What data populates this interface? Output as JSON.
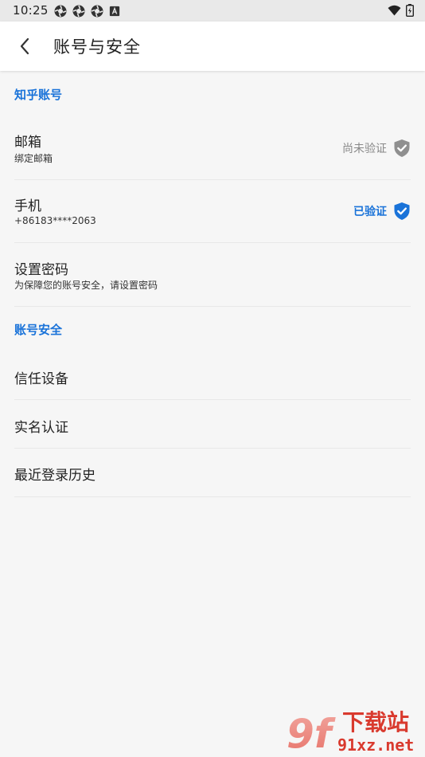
{
  "status_bar": {
    "time": "10:25",
    "icons": [
      "app-notification-icon",
      "app-notification-icon",
      "app-notification-icon",
      "keyboard-a-icon",
      "wifi-icon",
      "battery-icon"
    ]
  },
  "header": {
    "title": "账号与安全",
    "back_icon": "chevron-left-icon"
  },
  "sections": [
    {
      "title": "知乎账号",
      "items": [
        {
          "title": "邮箱",
          "subtitle": "绑定邮箱",
          "status": "尚未验证",
          "status_color": "#888888",
          "verified": false
        },
        {
          "title": "手机",
          "subtitle": "+86183****2063",
          "status": "已验证",
          "status_color": "#1a73d9",
          "verified": true
        },
        {
          "title": "设置密码",
          "subtitle": "为保障您的账号安全，请设置密码"
        }
      ]
    },
    {
      "title": "账号安全",
      "items": [
        {
          "title": "信任设备"
        },
        {
          "title": "实名认证"
        },
        {
          "title": "最近登录历史"
        }
      ]
    }
  ],
  "watermark": {
    "logo": "9f",
    "text_top": "下载站",
    "text_bottom": "91xz.net"
  },
  "colors": {
    "accent": "#1a73d9",
    "unverified": "#888888",
    "background": "#f6f6f6"
  }
}
